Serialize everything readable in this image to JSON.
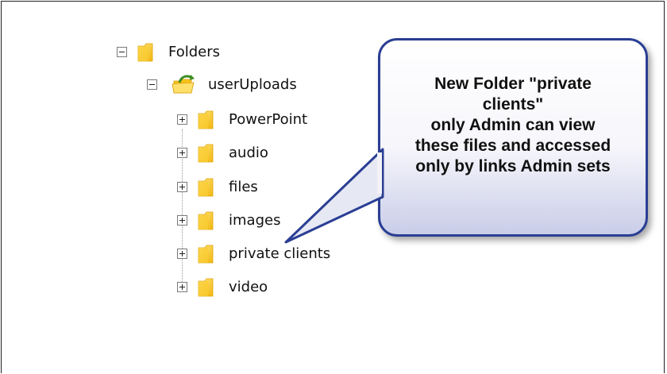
{
  "tree": {
    "root": {
      "label": "Folders",
      "expanded": true
    },
    "child": {
      "label": "userUploads",
      "expanded": true
    },
    "folders": [
      {
        "label": "PowerPoint"
      },
      {
        "label": "audio"
      },
      {
        "label": "files"
      },
      {
        "label": "images"
      },
      {
        "label": "private clients"
      },
      {
        "label": "video"
      }
    ]
  },
  "callout": {
    "lines": [
      "New Folder \"private",
      "clients\"",
      "only Admin can view",
      "these files and accessed",
      "only by links Admin sets"
    ],
    "border_color": "#2a3e93"
  },
  "colors": {
    "folder": "#f7c21b",
    "folder_light": "#ffe57a"
  }
}
